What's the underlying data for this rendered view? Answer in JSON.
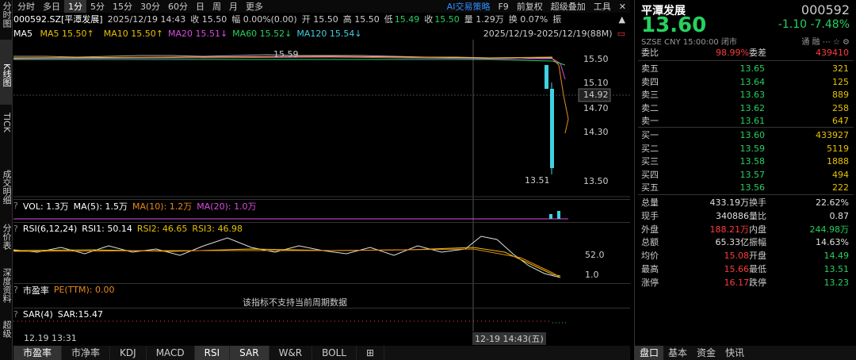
{
  "toolbar": {
    "items": [
      "分时",
      "多日",
      "1分",
      "5分",
      "15分",
      "30分",
      "60分",
      "日",
      "周",
      "月",
      "更多"
    ],
    "active": "1分",
    "ai": "AI交易策略",
    "f9": "F9",
    "fq": "前复权",
    "overlay": "超级叠加",
    "tools": "工具"
  },
  "infobar": {
    "code": "000592.SZ[平潭发展]",
    "datetime": "2025/12/19 14:43",
    "close": "收 15.50",
    "amp": "幅 0.00%(0.00)",
    "open": "开 15.50",
    "high": "高 15.50",
    "low_label": "低",
    "low": "15.49",
    "close_label": "收",
    "close2": "15.50",
    "vol": "量 1.29万",
    "turnover": "换 0.07%",
    "zhen": "振"
  },
  "ma": {
    "ma5": "MA5 15.50↑",
    "ma10": "MA10 15.50↑",
    "ma20": "MA20 15.51↓",
    "ma60": "MA60 15.52↓",
    "ma120": "MA120 15.54↓",
    "range": "2025/12/19-2025/12/19(88M)"
  },
  "left_tabs": [
    "分时图",
    "K线图",
    "TICK",
    "成交明细",
    "分价表",
    "深度资料",
    "超级"
  ],
  "price_axis": [
    "15.50",
    "15.10",
    "14.92",
    "14.70",
    "14.30",
    "13.50"
  ],
  "annotations": {
    "high": "15.59",
    "low": "13.51"
  },
  "vol": {
    "label": "VOL: 1.3万",
    "ma5": "MA(5): 1.5万",
    "ma10": "MA(10): 1.2万",
    "ma20": "MA(20): 1.0万"
  },
  "rsi": {
    "label": "RSI(6,12,24)",
    "rsi1": "RSI1: 50.14",
    "rsi2": "RSI2: 46.65",
    "rsi3": "RSI3: 46.98",
    "axis_hi": "52.0",
    "axis_lo": "1.0"
  },
  "pe": {
    "label": "市盈率",
    "value": "PE(TTM): 0.00",
    "notice": "该指标不支持当前周期数据"
  },
  "sar": {
    "label": "SAR(4)",
    "value": "SAR:15.47"
  },
  "xaxis": {
    "left": "12.19 13:31",
    "cursor": "12-19 14:43(五)"
  },
  "bottom_tabs": [
    "市盈率",
    "市净率",
    "KDJ",
    "MACD",
    "RSI",
    "SAR",
    "W&R",
    "BOLL",
    "⊞"
  ],
  "quote": {
    "name": "平潭发展",
    "code": "000592",
    "price": "13.60",
    "change": "-1.10",
    "pct": "-7.48%",
    "exch": "SZSE CNY 15:00:00 闭市",
    "tag": "通 融"
  },
  "weibi": {
    "label": "委比",
    "value": "98.99%",
    "label2": "委差",
    "value2": "439410"
  },
  "asks": [
    {
      "name": "卖五",
      "price": "13.65",
      "vol": "321"
    },
    {
      "name": "卖四",
      "price": "13.64",
      "vol": "125"
    },
    {
      "name": "卖三",
      "price": "13.63",
      "vol": "889"
    },
    {
      "name": "卖二",
      "price": "13.62",
      "vol": "258"
    },
    {
      "name": "卖一",
      "price": "13.61",
      "vol": "647"
    }
  ],
  "bids": [
    {
      "name": "买一",
      "price": "13.60",
      "vol": "433927"
    },
    {
      "name": "买二",
      "price": "13.59",
      "vol": "5119"
    },
    {
      "name": "买三",
      "price": "13.58",
      "vol": "1888"
    },
    {
      "name": "买四",
      "price": "13.57",
      "vol": "494"
    },
    {
      "name": "买五",
      "price": "13.56",
      "vol": "222"
    }
  ],
  "stats": [
    {
      "l1": "总量",
      "v1": "433.19万",
      "l2": "换手",
      "v2": "22.62%",
      "c1": "white",
      "c2": "white"
    },
    {
      "l1": "现手",
      "v1": "340886",
      "l2": "量比",
      "v2": "0.87",
      "c1": "white",
      "c2": "white"
    },
    {
      "l1": "外盘",
      "v1": "188.21万",
      "l2": "内盘",
      "v2": "244.98万",
      "c1": "red",
      "c2": "green"
    },
    {
      "l1": "总额",
      "v1": "65.33亿",
      "l2": "振幅",
      "v2": "14.63%",
      "c1": "white",
      "c2": "white"
    },
    {
      "l1": "均价",
      "v1": "15.08",
      "l2": "开盘",
      "v2": "14.49",
      "c1": "red",
      "c2": "green"
    },
    {
      "l1": "最高",
      "v1": "15.66",
      "l2": "最低",
      "v2": "13.51",
      "c1": "red",
      "c2": "green"
    },
    {
      "l1": "涨停",
      "v1": "16.17",
      "l2": "跌停",
      "v2": "13.23",
      "c1": "red",
      "c2": "green"
    }
  ],
  "right_tabs": [
    "盘口",
    "基本",
    "资金",
    "快讯"
  ]
}
